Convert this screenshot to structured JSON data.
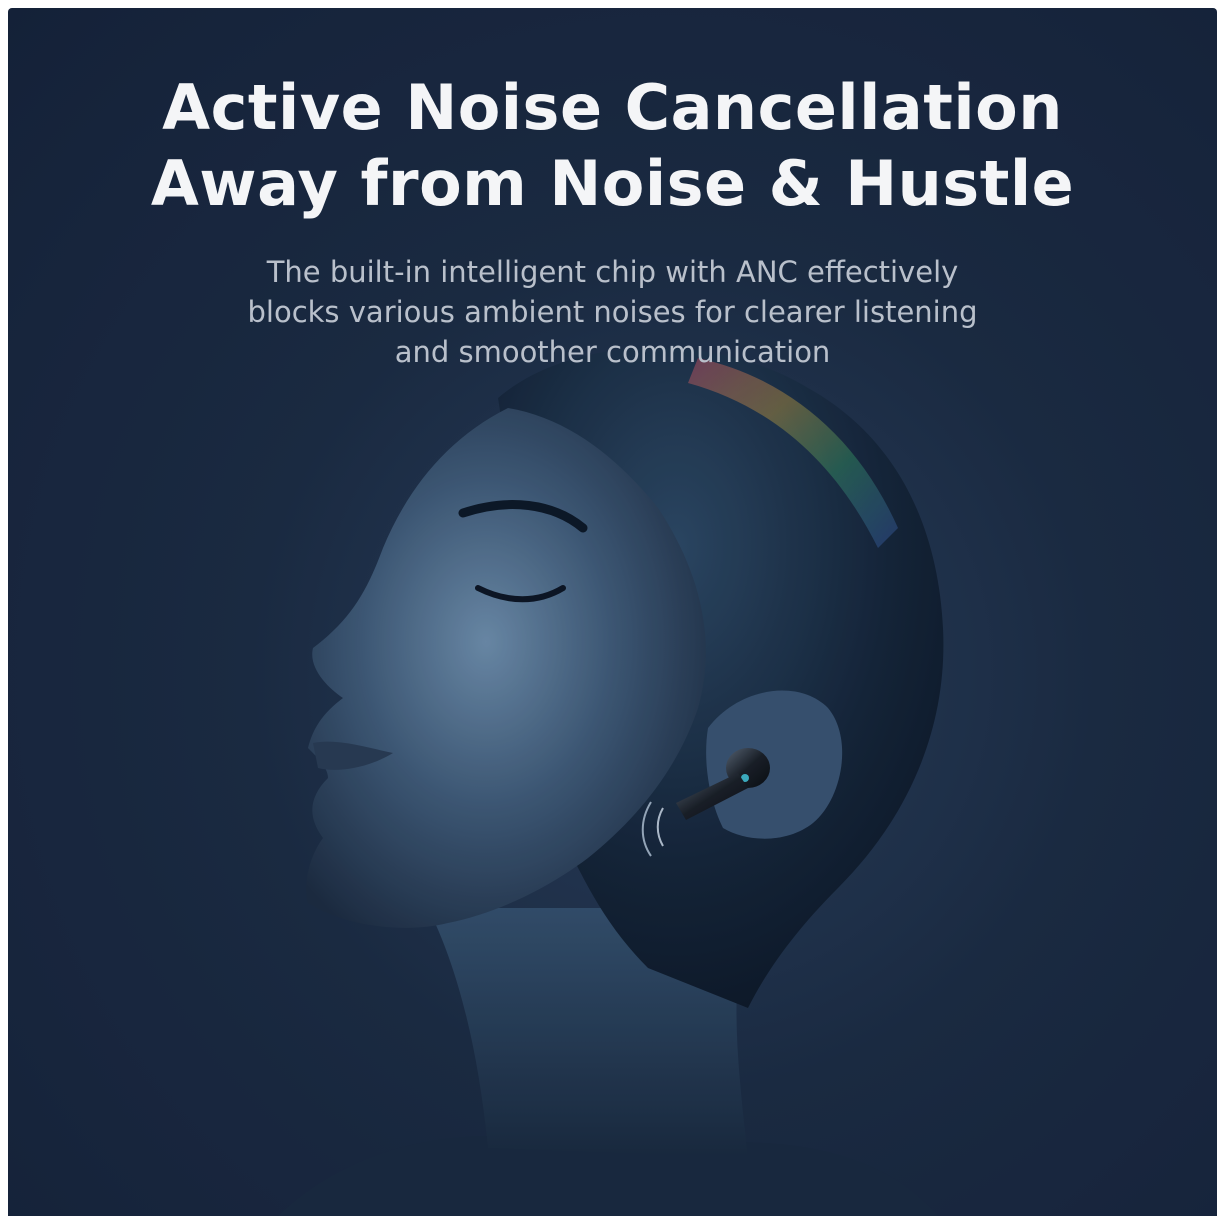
{
  "headline": {
    "line1": "Active Noise Cancellation",
    "line2": "Away from Noise & Hustle"
  },
  "subtitle": {
    "line1": "The built-in intelligent chip with ANC effectively",
    "line2": "blocks various ambient noises for clearer listening",
    "line3": "and smoother communication"
  },
  "colors": {
    "background": "#1c2c44",
    "headline": "#f4f5f7",
    "subtitle": "#b9c0cb"
  }
}
